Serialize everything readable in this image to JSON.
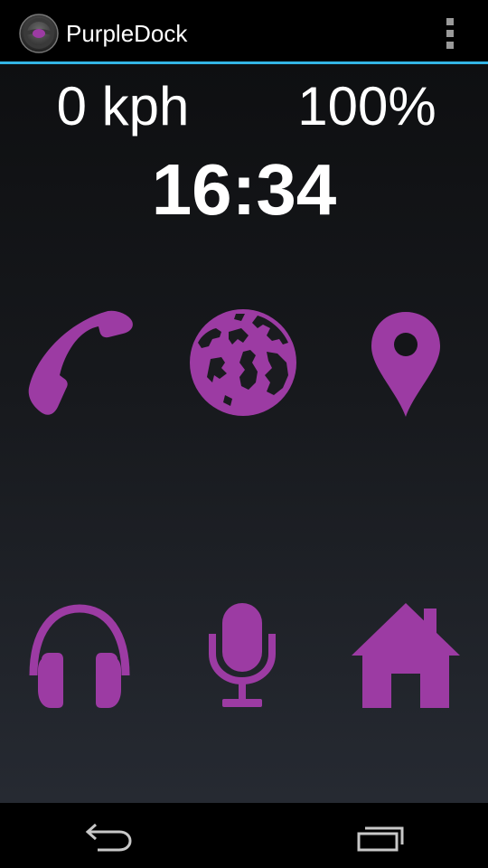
{
  "app": {
    "title": "PurpleDock",
    "accent_color": "#33b5e5",
    "icon_color": "#9c3ba3"
  },
  "header": {
    "app_icon": "steering-wheel-icon",
    "overflow_icon": "overflow-menu-icon"
  },
  "dashboard": {
    "speed": "0 kph",
    "battery": "100%",
    "time": "16:34"
  },
  "launcher": {
    "items": [
      {
        "name": "phone",
        "icon": "phone-icon"
      },
      {
        "name": "browser",
        "icon": "globe-icon"
      },
      {
        "name": "navigation",
        "icon": "map-pin-icon"
      },
      {
        "name": "music",
        "icon": "headphones-icon"
      },
      {
        "name": "voice",
        "icon": "microphone-icon"
      },
      {
        "name": "home",
        "icon": "home-icon"
      }
    ]
  },
  "system_nav": {
    "back_icon": "back-icon",
    "recents_icon": "recent-apps-icon"
  }
}
